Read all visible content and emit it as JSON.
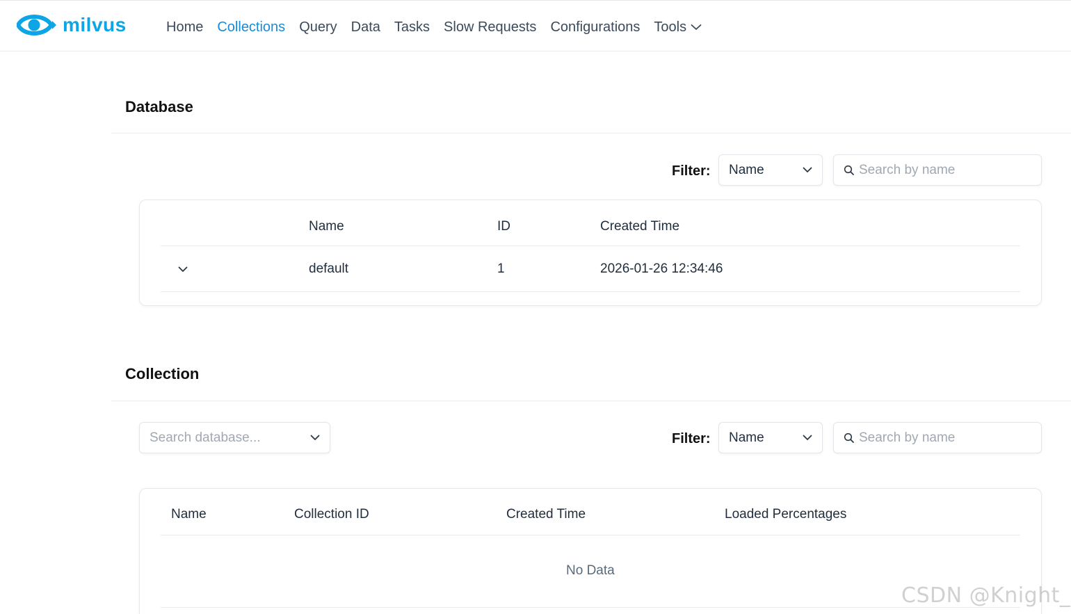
{
  "brand": {
    "name": "milvus",
    "color": "#0da5e5"
  },
  "nav": {
    "items": [
      {
        "label": "Home"
      },
      {
        "label": "Collections",
        "active": true
      },
      {
        "label": "Query"
      },
      {
        "label": "Data"
      },
      {
        "label": "Tasks"
      },
      {
        "label": "Slow Requests"
      },
      {
        "label": "Configurations"
      },
      {
        "label": "Tools",
        "icon": "chevron-down-icon"
      }
    ],
    "active_color": "#1a8ad8"
  },
  "database": {
    "title": "Database",
    "filter_label": "Filter:",
    "filter_value": "Name",
    "search_placeholder": "Search by name",
    "columns": [
      "Name",
      "ID",
      "Created Time"
    ],
    "rows": [
      {
        "expand_icon": "chevron-down-icon",
        "name": "default",
        "id": "1",
        "created_time": "2026-01-26 12:34:46"
      }
    ]
  },
  "collection": {
    "title": "Collection",
    "database_select_placeholder": "Search database...",
    "filter_label": "Filter:",
    "filter_value": "Name",
    "search_placeholder": "Search by name",
    "columns": [
      "Name",
      "Collection ID",
      "Created Time",
      "Loaded Percentages"
    ],
    "empty_text": "No Data"
  },
  "watermark": "CSDN @Knight_AL"
}
